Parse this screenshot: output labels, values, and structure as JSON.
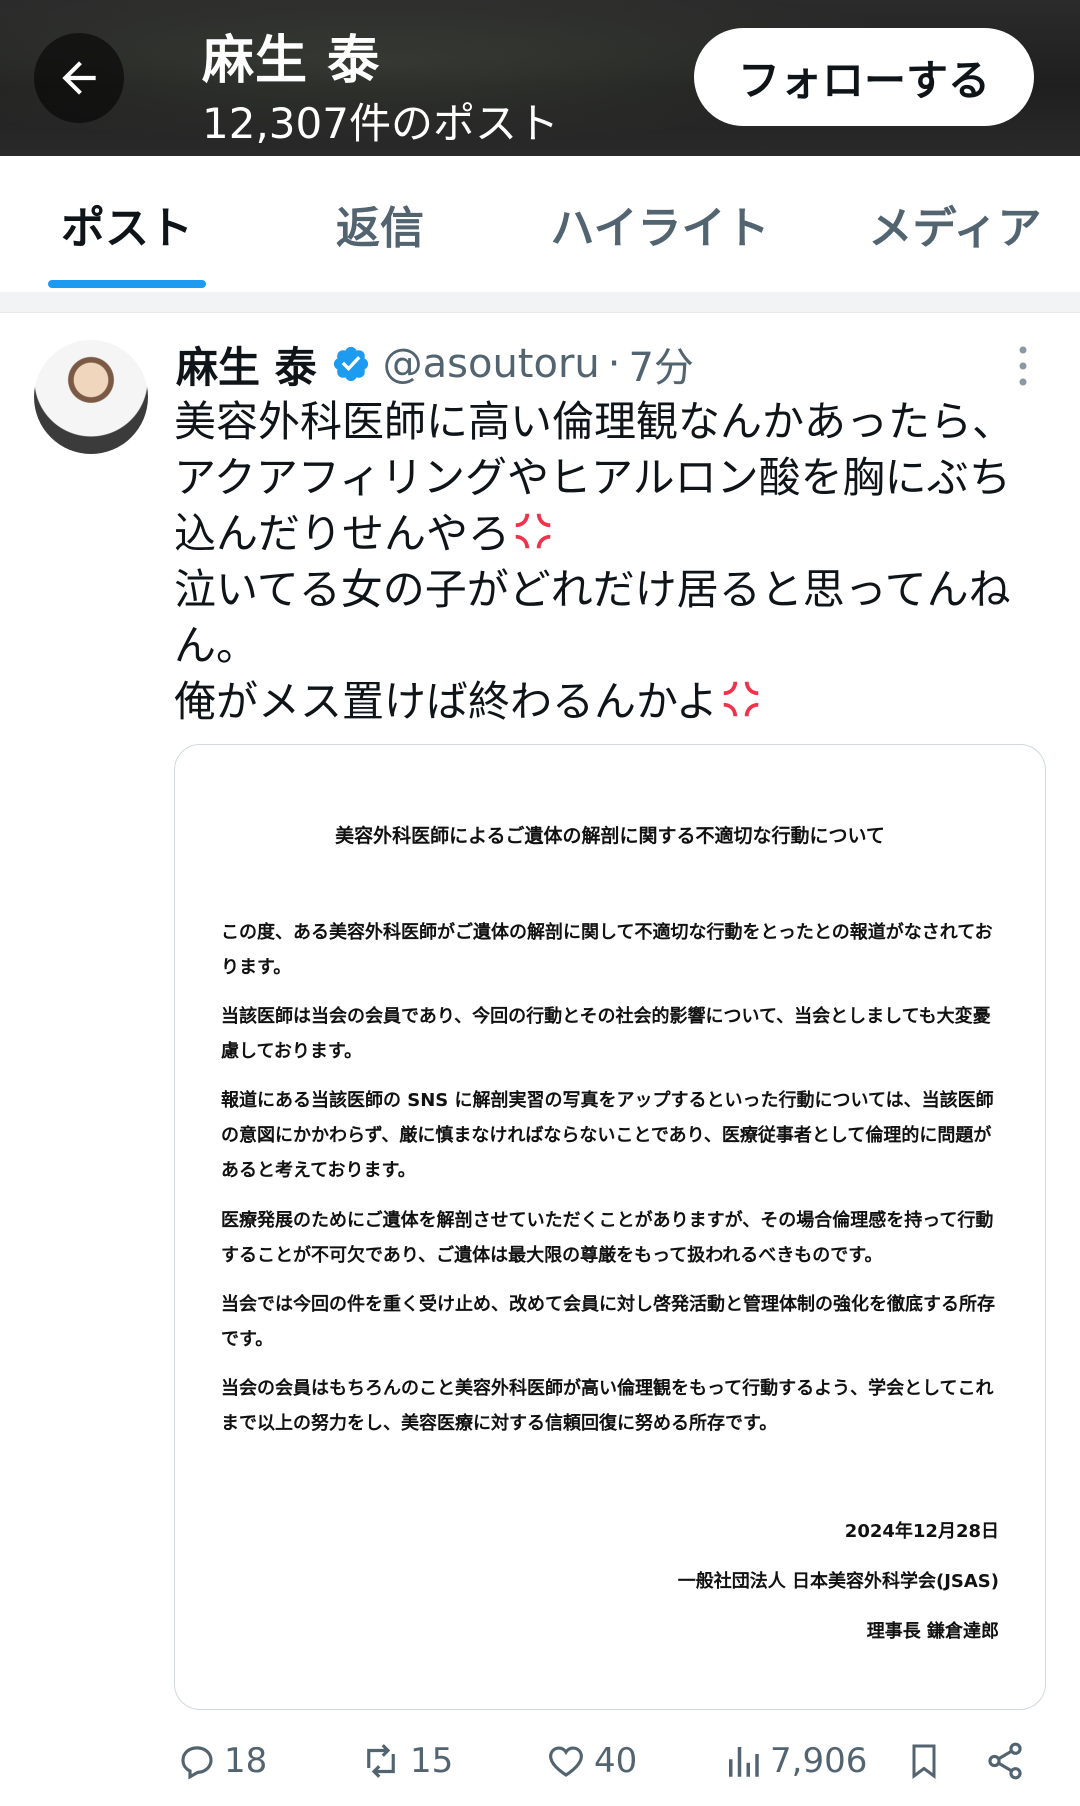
{
  "header": {
    "name": "麻生 泰",
    "post_count": "12,307件のポスト",
    "follow_label": "フォローする"
  },
  "tabs": [
    {
      "label": "ポスト",
      "active": true
    },
    {
      "label": "返信",
      "active": false
    },
    {
      "label": "ハイライト",
      "active": false
    },
    {
      "label": "メディア",
      "active": false
    }
  ],
  "post": {
    "name": "麻生 泰",
    "handle": "@asoutoru",
    "separator": "·",
    "time": "7分",
    "text_lines": [
      "美容外科医師に高い倫理観なんかあったら、",
      "アクアフィリングやヒアルロン酸を胸にぶち",
      "込んだりせんやろ",
      "泣いてる女の子がどれだけ居ると思ってんね",
      "ん。",
      "俺がメス置けば終わるんかよ"
    ],
    "emoji": "anger-symbol",
    "accent_color": "#1d9bf0",
    "emoji_color": "#f4314b"
  },
  "document": {
    "title": "美容外科医師によるご遺体の解剖に関する不適切な行動について",
    "paragraphs": [
      "この度、ある美容外科医師がご遺体の解剖に関して不適切な行動をとったとの報道がなされております。",
      "当該医師は当会の会員であり、今回の行動とその社会的影響について、当会としましても大変憂慮しております。",
      "報道にある当該医師の SNS に解剖実習の写真をアップするといった行動については、当該医師の意図にかかわらず、厳に慎まなければならないことであり、医療従事者として倫理的に問題があると考えております。",
      "医療発展のためにご遺体を解剖させていただくことがありますが、その場合倫理感を持って行動することが不可欠であり、ご遺体は最大限の尊厳をもって扱われるべきものです。",
      "当会では今回の件を重く受け止め、改めて会員に対し啓発活動と管理体制の強化を徹底する所存です。",
      "当会の会員はもちろんのこと美容外科医師が高い倫理観をもって行動するよう、学会としてこれまで以上の努力をし、美容医療に対する信頼回復に努める所存です。"
    ],
    "date": "2024年12月28日",
    "organization": "一般社団法人 日本美容外科学会(JSAS)",
    "signatory": "理事長 鎌倉達郎"
  },
  "actions": {
    "replies": "18",
    "reposts": "15",
    "likes": "40",
    "views": "7,906"
  }
}
